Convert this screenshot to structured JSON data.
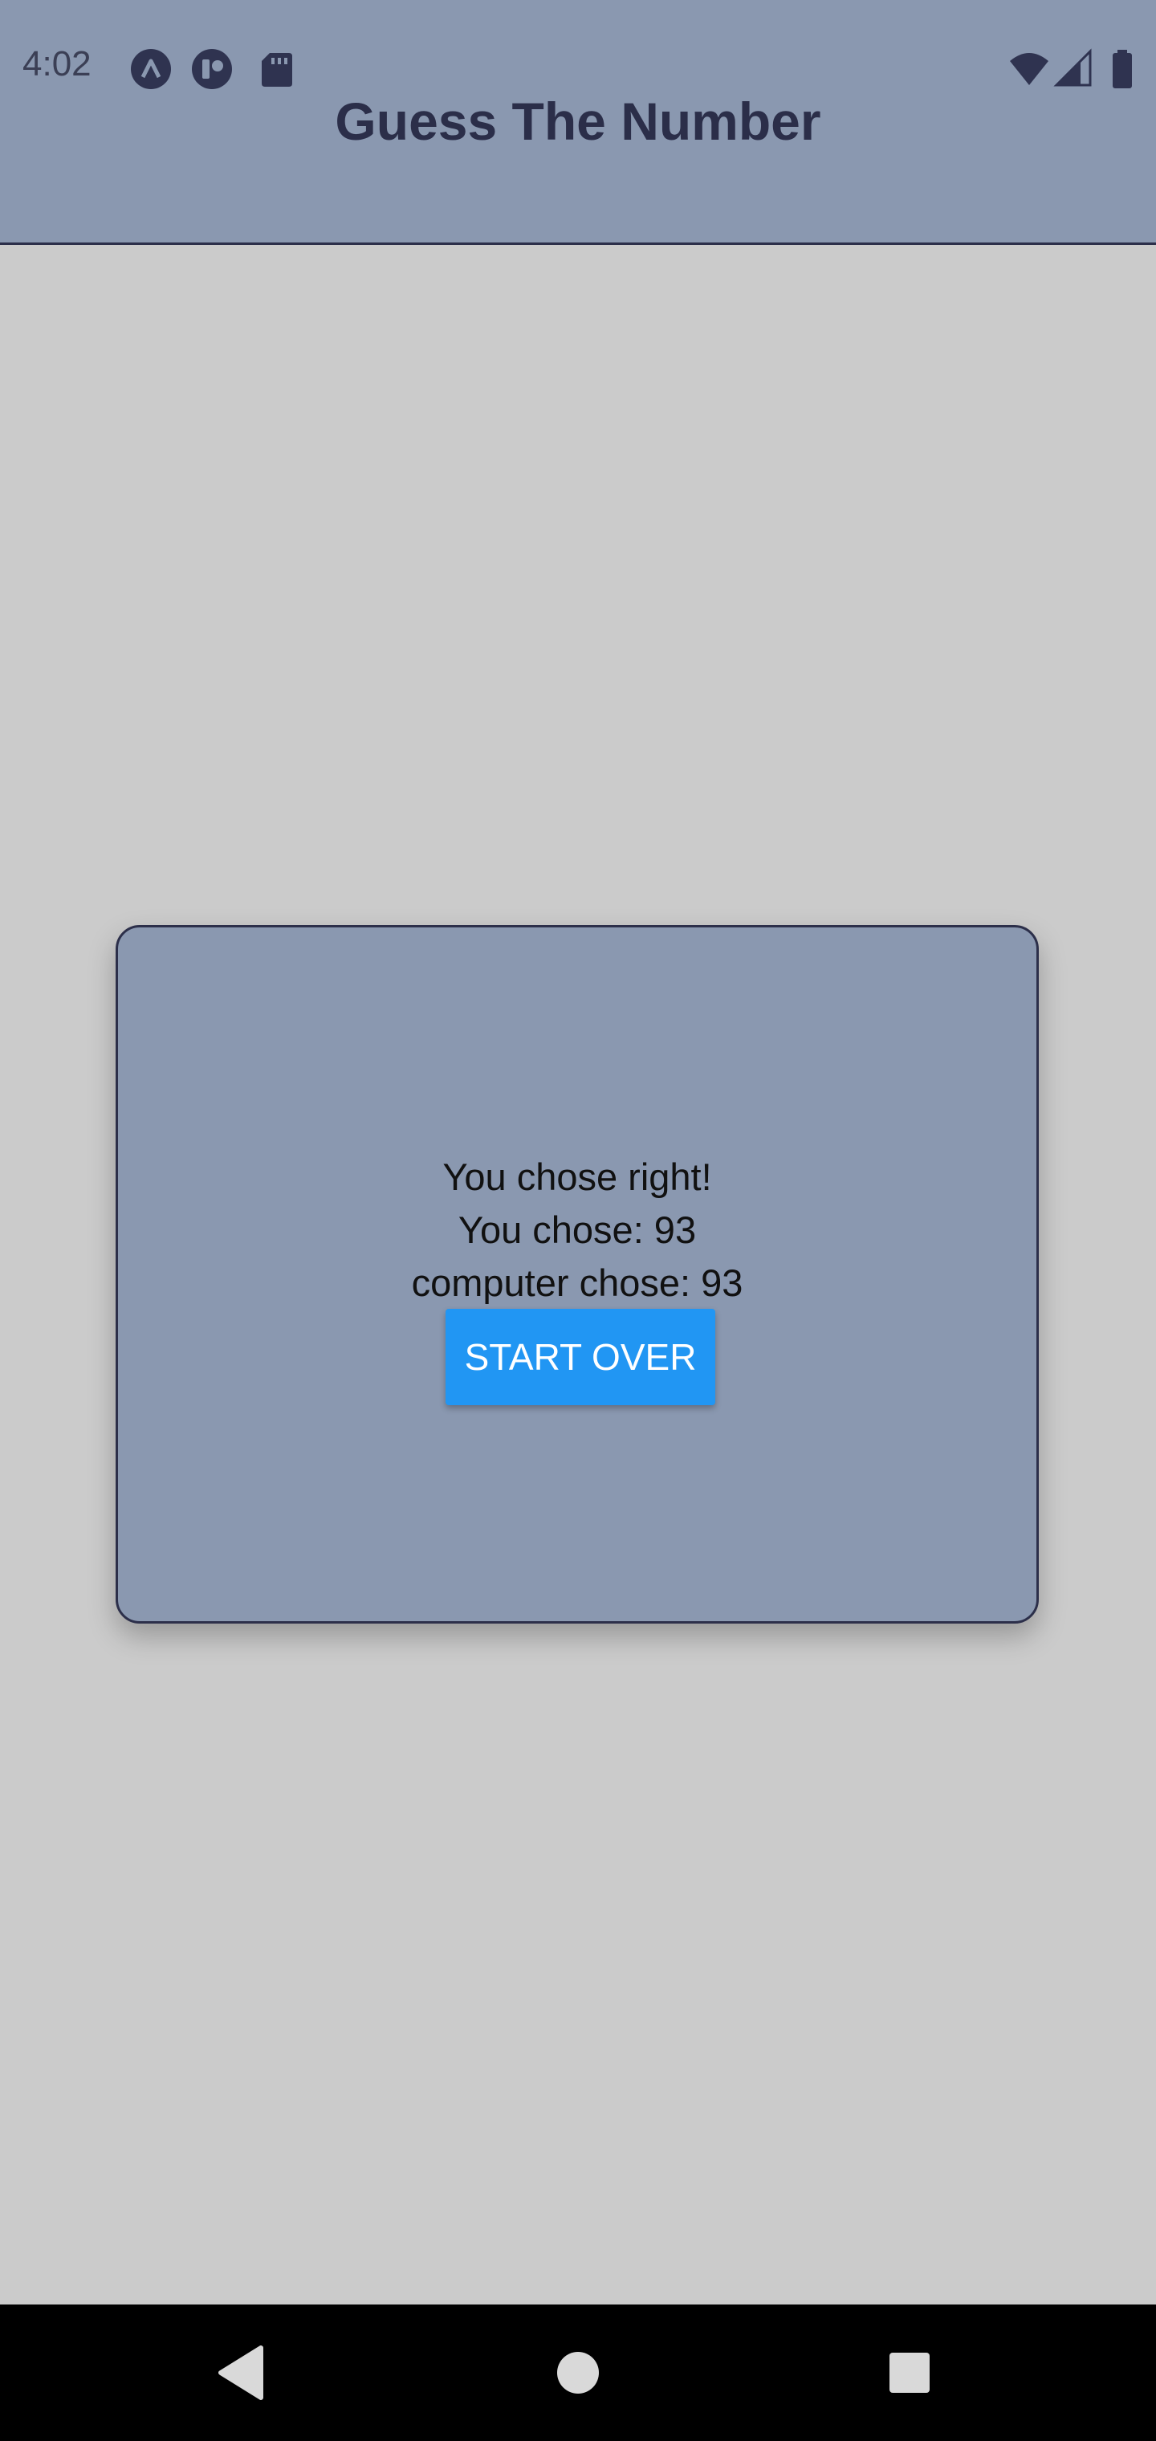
{
  "status_bar": {
    "time": "4:02",
    "left_icons": [
      "app-a-icon",
      "app-b-icon",
      "sd-card-icon"
    ],
    "right_icons": [
      "wifi-icon",
      "signal-icon",
      "battery-icon"
    ]
  },
  "header": {
    "title": "Guess The Number"
  },
  "result_card": {
    "message": "You chose right!",
    "user_choice": "You chose: 93",
    "computer_choice": "computer chose: 93",
    "start_over_label": "START OVER"
  },
  "nav_bar": {
    "buttons": [
      "back-icon",
      "home-icon",
      "recents-icon"
    ]
  },
  "colors": {
    "header_bg": "#8a98b0",
    "page_bg": "#cbcbcb",
    "title_text": "#2b2e49",
    "button": "#2196f3"
  }
}
